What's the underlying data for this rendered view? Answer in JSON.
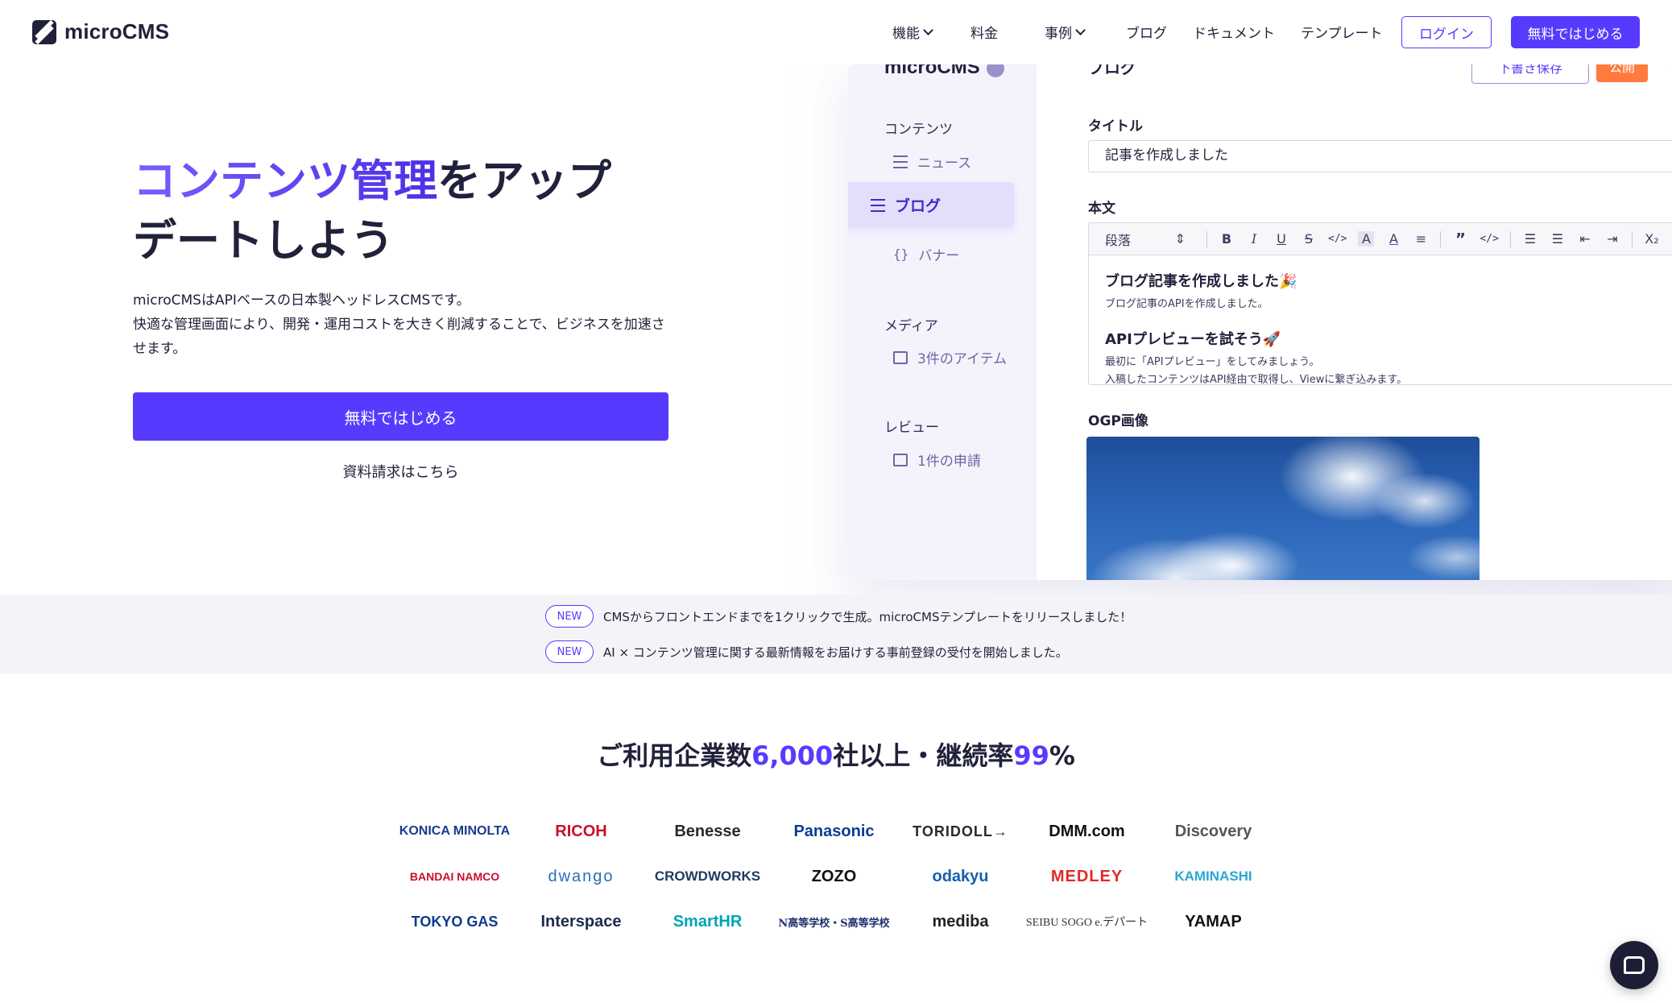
{
  "header": {
    "logo_text": "microCMS",
    "nav": [
      {
        "label": "機能",
        "dropdown": true
      },
      {
        "label": "料金",
        "dropdown": false
      },
      {
        "label": "事例",
        "dropdown": true
      },
      {
        "label": "ブログ",
        "dropdown": false
      },
      {
        "label": "ドキュメント",
        "dropdown": false
      },
      {
        "label": "テンプレート",
        "dropdown": false
      }
    ],
    "login_label": "ログイン",
    "start_label": "無料ではじめる"
  },
  "hero": {
    "title_accent": "コンテンツ管理",
    "title_rest_1": "をアップ",
    "title_rest_2": "デートしよう",
    "desc_1": "microCMSはAPIベースの日本製ヘッドレスCMSです。",
    "desc_2": "快適な管理画面により、開発・運用コストを大きく削減することで、ビジネスを加速させます。",
    "cta_label": "無料ではじめる",
    "doc_link": "資料請求はこちら"
  },
  "mock": {
    "brand": "microCMS",
    "sections": {
      "contents": "コンテンツ",
      "media": "メディア",
      "review": "レビュー"
    },
    "items": {
      "news": "ニュース",
      "blog": "ブログ",
      "banner": "バナー",
      "media_items": "3件のアイテム",
      "review_requests": "1件の申請"
    },
    "breadcrumb": "ブログ",
    "draft_label": "下書き保存",
    "publish_label": "公開",
    "title_label": "タイトル",
    "title_value": "記事を作成しました",
    "body_label": "本文",
    "toolbar_select": "段落",
    "body": {
      "h1": "ブログ記事を作成しました🎉",
      "p1": "ブログ記事のAPIを作成しました。",
      "h2": "APIプレビューを試そう🚀",
      "p2": "最初に「APIプレビュー」をしてみましょう。",
      "p3": "入稿したコンテンツはAPI経由で取得し、Viewに繋ぎ込みます。"
    },
    "ogp_label": "OGP画像"
  },
  "news": [
    {
      "badge": "NEW",
      "text": "CMSからフロントエンドまでを1クリックで生成。microCMSテンプレートをリリースしました！"
    },
    {
      "badge": "NEW",
      "text": "AI × コンテンツ管理に関する最新情報をお届けする事前登録の受付を開始しました。"
    }
  ],
  "stats": {
    "prefix": "ご利用企業数",
    "companies": "6,000",
    "middle": "社以上・継続率",
    "rate": "99",
    "suffix": "%"
  },
  "logos": [
    [
      {
        "name": "KONICA MINOLTA",
        "color": "#1a3a8c"
      },
      {
        "name": "RICOH",
        "color": "#c8102e"
      },
      {
        "name": "Benesse",
        "color": "#2a2a2a"
      },
      {
        "name": "Panasonic",
        "color": "#0a3d91"
      },
      {
        "name": "TORIDOLL→",
        "color": "#2a2a2a"
      },
      {
        "name": "DMM.com",
        "color": "#111111"
      },
      {
        "name": "Discovery",
        "color": "#555555"
      }
    ],
    [
      {
        "name": "BANDAI NAMCO",
        "color": "#c8102e"
      },
      {
        "name": "dwango",
        "color": "#2a6fb5"
      },
      {
        "name": "CROWDWORKS",
        "color": "#1f3b63"
      },
      {
        "name": "ZOZO",
        "color": "#111111"
      },
      {
        "name": "odakyu",
        "color": "#1660b0"
      },
      {
        "name": "MEDLEY",
        "color": "#e02a2a"
      },
      {
        "name": "KAMINASHI",
        "color": "#2aa6d6"
      }
    ],
    [
      {
        "name": "TOKYO GAS",
        "color": "#0b3c8c"
      },
      {
        "name": "Interspace",
        "color": "#1c2b4d"
      },
      {
        "name": "SmartHR",
        "color": "#00a4b4"
      },
      {
        "name": "N高等学校・S高等学校",
        "color": "#1f2f6b"
      },
      {
        "name": "mediba",
        "color": "#222222"
      },
      {
        "name": "SEIBU SOGO e.デパート",
        "color": "#333333"
      },
      {
        "name": "YAMAP",
        "color": "#111111"
      }
    ]
  ],
  "colors": {
    "accent": "#563bff",
    "text": "#21213b",
    "publish": "#ff7a3d"
  }
}
